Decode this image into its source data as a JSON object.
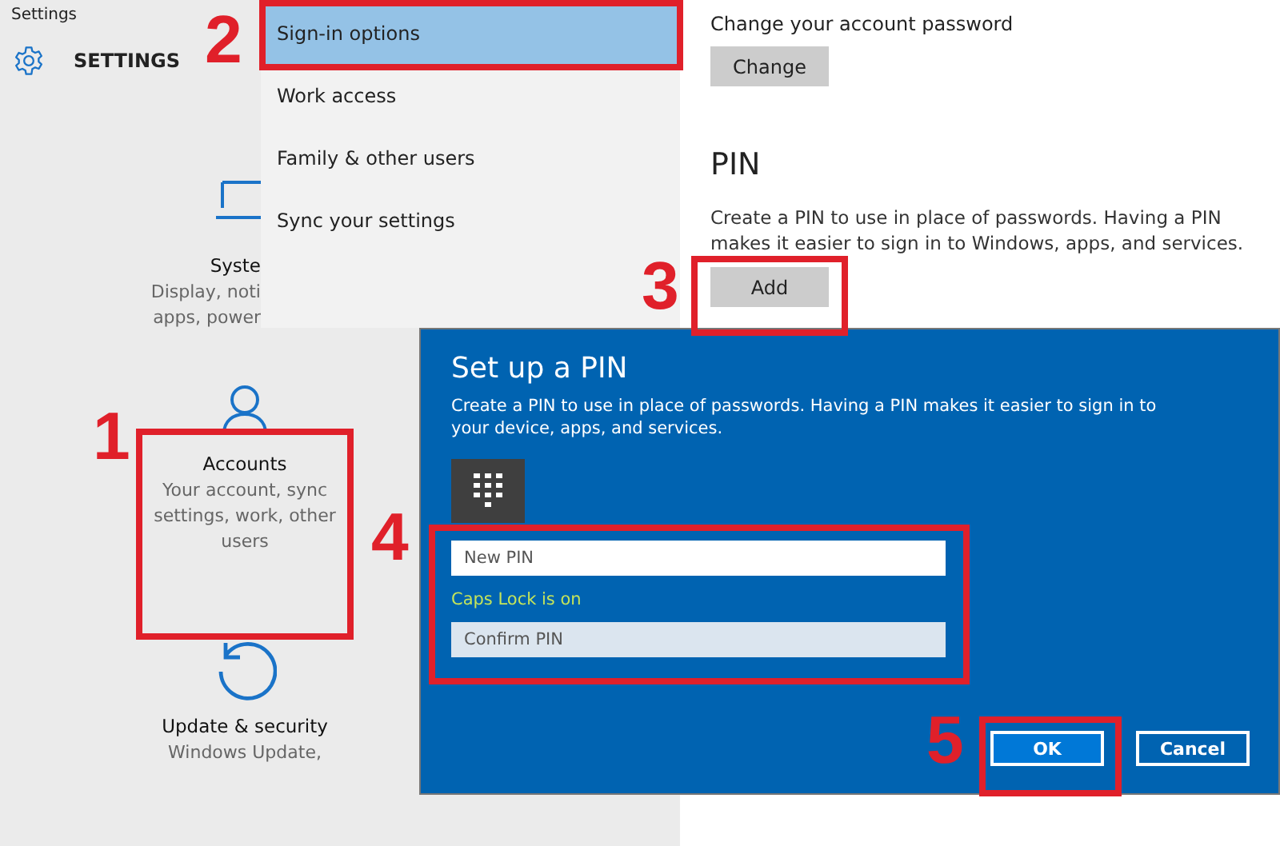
{
  "window": {
    "title": "Settings"
  },
  "header": {
    "title": "SETTINGS"
  },
  "tiles": [
    {
      "kind": "laptop",
      "title": "Syste",
      "lines": [
        "Display, noti",
        "apps, power"
      ]
    },
    {
      "kind": "person",
      "title": "Accounts",
      "lines": [
        "Your account, sync",
        "settings, work, other",
        "users"
      ]
    },
    {
      "kind": "update",
      "title": "Update & security",
      "lines": [
        "Windows Update,"
      ]
    }
  ],
  "menu": {
    "items": [
      {
        "label": "Sign-in options",
        "selected": true
      },
      {
        "label": "Work access",
        "selected": false
      },
      {
        "label": "Family & other users",
        "selected": false
      },
      {
        "label": "Sync your settings",
        "selected": false
      }
    ]
  },
  "password": {
    "label": "Change your account password",
    "button": "Change"
  },
  "pin": {
    "heading": "PIN",
    "description": "Create a PIN to use in place of passwords. Having a PIN makes it easier to sign in to Windows, apps, and services.",
    "button": "Add"
  },
  "dialog": {
    "title": "Set up a PIN",
    "description": "Create a PIN to use in place of passwords. Having a PIN makes it easier to sign in to your device, apps, and services.",
    "new_pin": {
      "placeholder": "New PIN"
    },
    "caps_warning": "Caps Lock is on",
    "confirm_pin": {
      "placeholder": "Confirm PIN"
    },
    "buttons": [
      {
        "label": "OK",
        "kind": "primary"
      },
      {
        "label": "Cancel",
        "kind": "secondary"
      }
    ]
  },
  "annotations": [
    {
      "number": "1"
    },
    {
      "number": "2"
    },
    {
      "number": "3"
    },
    {
      "number": "4"
    },
    {
      "number": "5"
    }
  ]
}
